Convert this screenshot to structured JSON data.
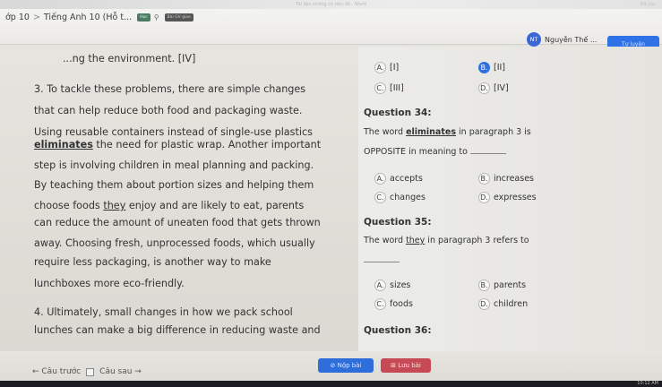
{
  "window": {
    "title": "Tài liệu không có tiêu đề - Word",
    "right": "Đã lưu"
  },
  "breadcrumb": {
    "class": "ớp 10",
    "sep": ">",
    "course": "Tiếng Anh 10 (Hỗ t...",
    "tag1": "Học",
    "tag2": "Bài GV giao"
  },
  "user": {
    "initials": "NT",
    "name": "Nguyễn Thế ..."
  },
  "turnin_label": "Tự luyện",
  "passage": {
    "l0": "...ng the environment. [IV]",
    "l1a": "3. To tackle these problems, there are simple changes",
    "l2a": "that can help reduce both food and packaging waste.",
    "l3a": "Using reusable containers instead of single-use plastics",
    "l4_em": "eliminates",
    "l4b": " the need for plastic wrap. Another important",
    "l5": "step is involving children in meal planning and packing.",
    "l6a": "By teaching them about portion sizes and helping them",
    "l7": "choose foods ",
    "l7_em": "they",
    "l7b": " enjoy and are likely to eat, parents",
    "l8": "can reduce the amount of uneaten food that gets thrown",
    "l9": "away. Choosing fresh, unprocessed foods, which usually",
    "l10": "require less packaging, is another way to make",
    "l11": "lunchboxes more eco-friendly.",
    "l12": "4. Ultimately, small changes in how we pack school",
    "l13": "lunches can make a big difference in reducing waste and"
  },
  "q33": {
    "options": [
      {
        "letter": "A.",
        "text": "[I]"
      },
      {
        "letter": "B.",
        "text": "[II]",
        "selected": true
      },
      {
        "letter": "C.",
        "text": "[III]"
      },
      {
        "letter": "D.",
        "text": "[IV]"
      }
    ]
  },
  "q34": {
    "title": "Question 34:",
    "line1a": "The word ",
    "line1_em": "eliminates",
    "line1b": " in paragraph 3 is",
    "line2": "OPPOSITE in meaning to",
    "options": [
      {
        "letter": "A.",
        "text": "accepts"
      },
      {
        "letter": "B.",
        "text": "increases"
      },
      {
        "letter": "C.",
        "text": "changes"
      },
      {
        "letter": "D.",
        "text": "expresses"
      }
    ]
  },
  "q35": {
    "title": "Question 35:",
    "line1a": "The word ",
    "line1_em": "they",
    "line1b": " in paragraph 3 refers to",
    "options": [
      {
        "letter": "A.",
        "text": "sizes"
      },
      {
        "letter": "B.",
        "text": "parents"
      },
      {
        "letter": "C.",
        "text": "foods"
      },
      {
        "letter": "D.",
        "text": "children"
      }
    ]
  },
  "q36": {
    "title": "Question 36:"
  },
  "nav": {
    "prev": "← Câu trước",
    "next": "Câu sau →",
    "submit": "⊘ Nộp bài",
    "save": "⊞ Lưu bài"
  },
  "clock": "10:12 AM"
}
